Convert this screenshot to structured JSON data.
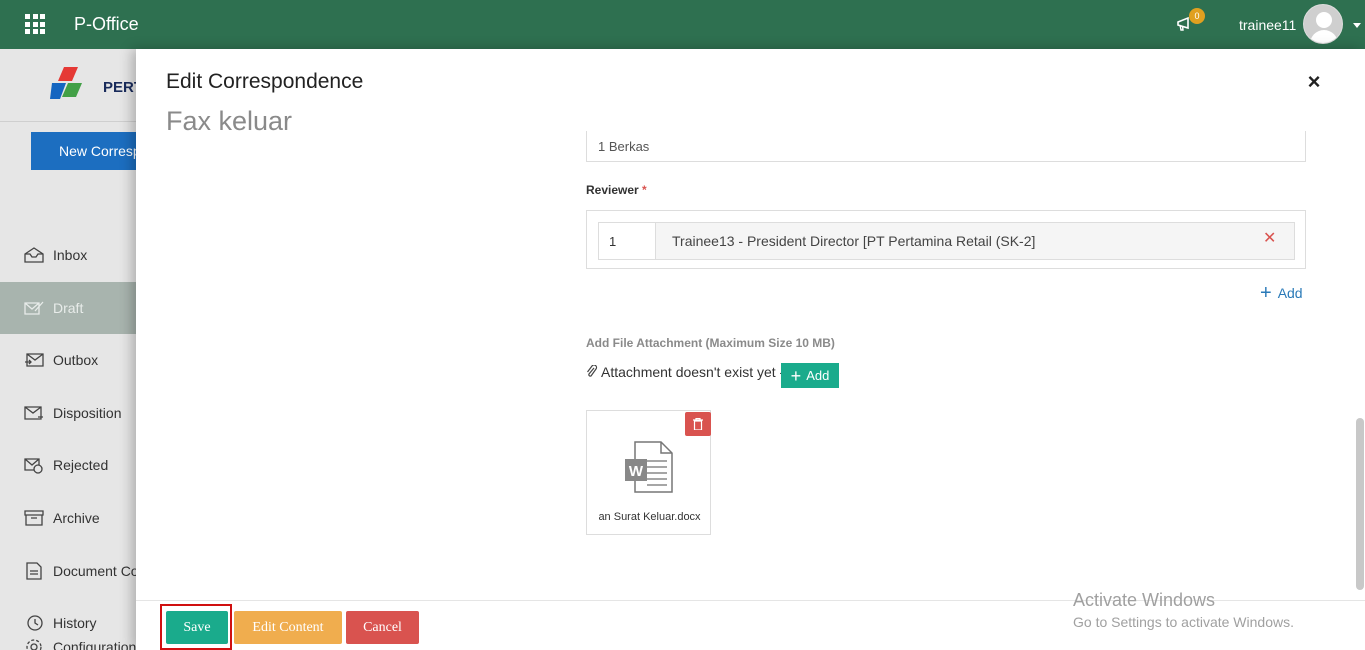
{
  "topbar": {
    "app_title": "P-Office",
    "notification_count": "0",
    "username": "trainee11"
  },
  "sidebar": {
    "logo_text": "PERT",
    "new_button_label": "New Correspondence",
    "items": [
      {
        "label": "Inbox",
        "icon": "inbox-icon"
      },
      {
        "label": "Draft",
        "icon": "draft-icon"
      },
      {
        "label": "Outbox",
        "icon": "outbox-icon"
      },
      {
        "label": "Disposition",
        "icon": "disposition-icon"
      },
      {
        "label": "Rejected",
        "icon": "rejected-icon"
      },
      {
        "label": "Archive",
        "icon": "archive-icon"
      },
      {
        "label": "Document Control",
        "icon": "document-icon"
      },
      {
        "label": "History",
        "icon": "history-icon"
      },
      {
        "label": "Configuration",
        "icon": "gear-icon"
      }
    ],
    "active_item": "Draft"
  },
  "modal": {
    "title": "Edit Correspondence",
    "subtitle": "Fax keluar",
    "attachment_count_value": "1 Berkas",
    "reviewer": {
      "label": "Reviewer",
      "required_mark": "*",
      "rows": [
        {
          "order": "1",
          "name": "Trainee13 - President Director [PT Pertamina Retail (SK-2]"
        }
      ],
      "add_label": "Add"
    },
    "attachments": {
      "label": "Add File Attachment (Maximum Size 10 MB)",
      "status_text": "Attachment doesn't exist yet -",
      "add_button_label": "Add",
      "files": [
        {
          "name": "an Surat Keluar.docx",
          "type": "word"
        }
      ]
    },
    "buttons": {
      "save": "Save",
      "edit_content": "Edit Content",
      "cancel": "Cancel"
    }
  },
  "watermark": {
    "line1": "Activate Windows",
    "line2": "Go to Settings to activate Windows."
  },
  "colors": {
    "topbar": "#2e7050",
    "primary_button": "#1c6ec0",
    "save": "#1aab8c",
    "edit": "#f0ad4e",
    "cancel": "#d9534f"
  }
}
